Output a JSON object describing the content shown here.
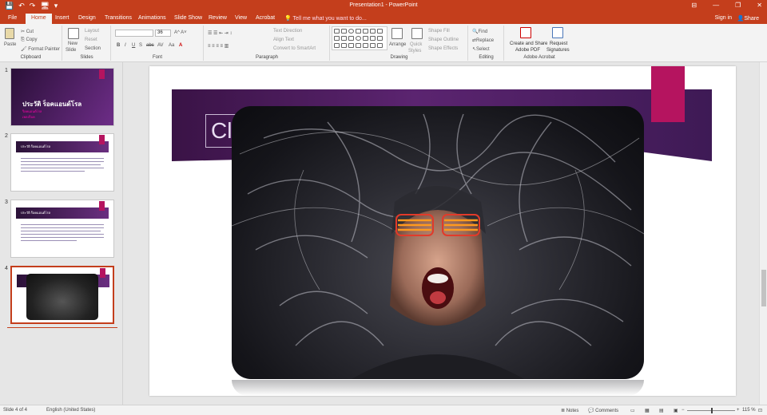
{
  "titlebar": {
    "title": "Presentation1 - PowerPoint",
    "qat": [
      "💾",
      "↶",
      "↷",
      "🖥",
      "▾"
    ],
    "controls": [
      "⊟",
      "—",
      "❐",
      "✕"
    ]
  },
  "tabs": [
    "File",
    "Home",
    "Insert",
    "Design",
    "Transitions",
    "Animations",
    "Slide Show",
    "Review",
    "View",
    "Acrobat"
  ],
  "tellme": "Tell me what you want to do...",
  "signin": "Sign in",
  "share": "Share",
  "ribbon": {
    "clipboard": {
      "label": "Clipboard",
      "paste": "Paste",
      "cut": "Cut",
      "copy": "Copy",
      "painter": "Format Painter"
    },
    "slides": {
      "label": "Slides",
      "new": "New",
      "slide": "Slide",
      "layout": "Layout",
      "reset": "Reset",
      "section": "Section"
    },
    "font": {
      "label": "Font",
      "size": "36",
      "b": "B",
      "i": "I",
      "u": "U",
      "s": "S",
      "abc": "abc",
      "av": "AV",
      "aa": "Aa",
      "a": "A"
    },
    "paragraph": {
      "label": "Paragraph",
      "dir": "Text Direction",
      "align": "Align Text",
      "convert": "Convert to SmartArt"
    },
    "drawing": {
      "label": "Drawing",
      "arrange": "Arrange",
      "quick": "Quick",
      "styles": "Styles",
      "fill": "Shape Fill",
      "outline": "Shape Outline",
      "effects": "Shape Effects"
    },
    "editing": {
      "label": "Editing",
      "find": "Find",
      "replace": "Replace",
      "select": "Select"
    },
    "acrobat": {
      "label": "Adobe Acrobat",
      "create1": "Create and Share",
      "create2": "Adobe PDF",
      "req1": "Request",
      "req2": "Signatures"
    }
  },
  "slides": [
    {
      "num": "1",
      "title": "ประวัติ ร็อคแอนด์โรล",
      "sub1": "ร็อคแอนด์โรล",
      "sub2": "เพลงร็อค"
    },
    {
      "num": "2",
      "title": "ประวัติ ร็อคแอนด์โรล"
    },
    {
      "num": "3",
      "title": "ประวัติ ร็อคแอนด์โรล"
    },
    {
      "num": "4"
    }
  ],
  "slide": {
    "title": "Cli"
  },
  "status": {
    "slide": "Slide 4 of 4",
    "lang": "English (United States)",
    "notes": "Notes",
    "comments": "Comments",
    "zoom": "115 %"
  }
}
